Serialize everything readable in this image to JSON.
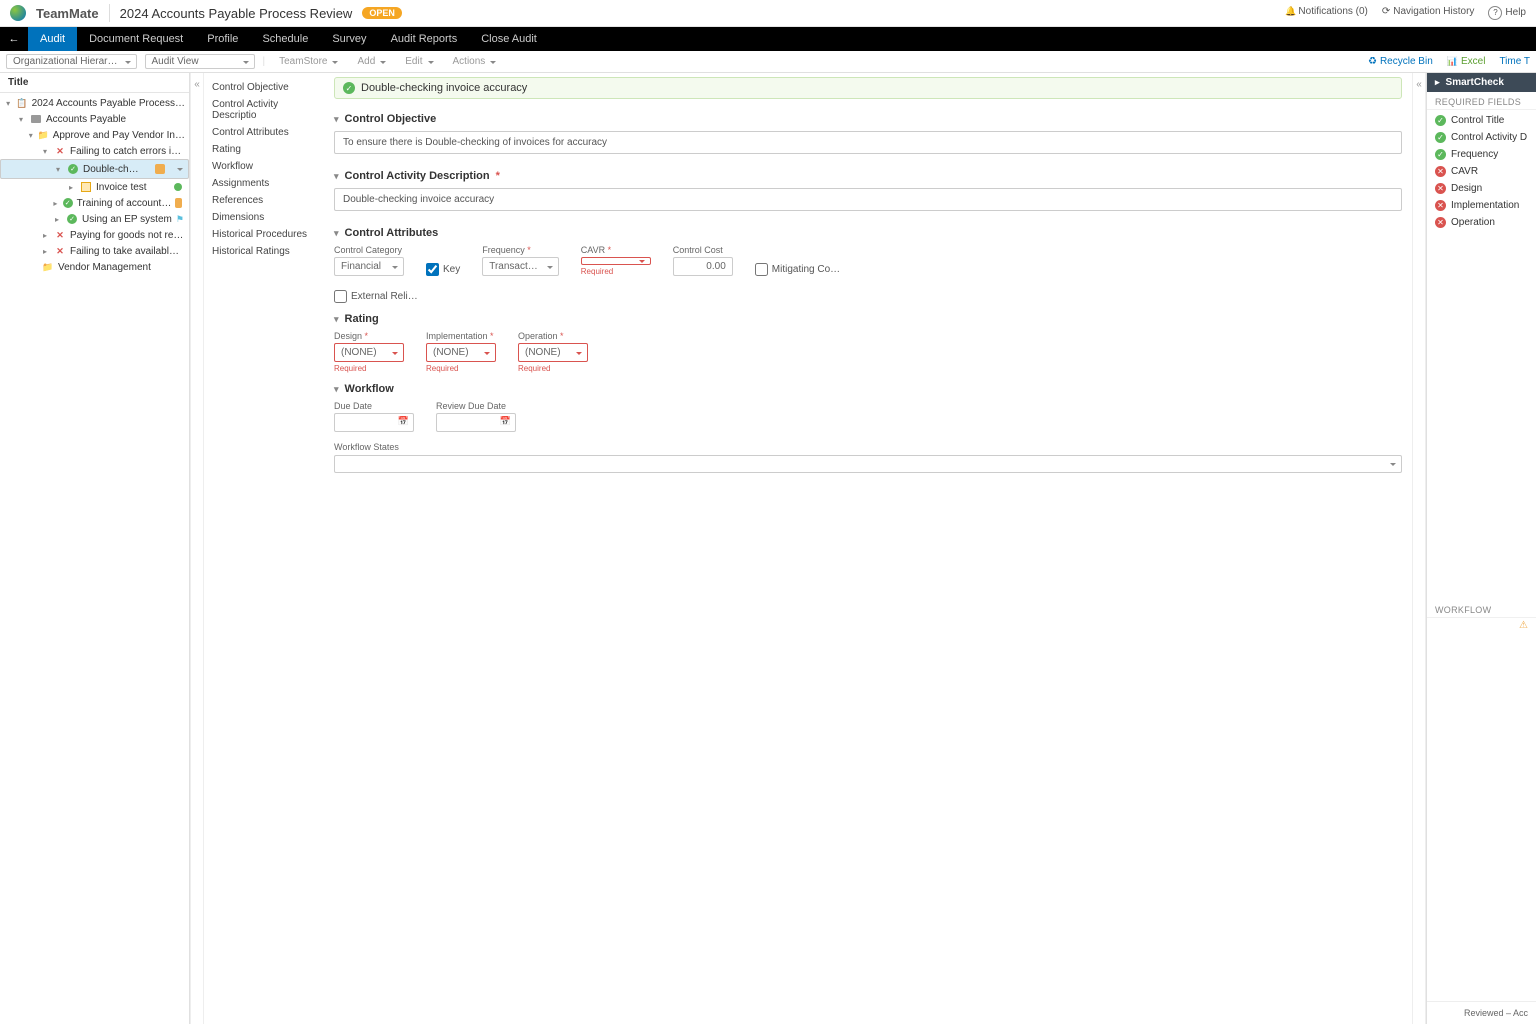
{
  "header": {
    "app": "TeamMate",
    "title": "2024 Accounts Payable Process Review",
    "status": "OPEN",
    "notifications": "Notifications (0)",
    "navhistory": "Navigation History",
    "help": "Help"
  },
  "blackbar": {
    "tabs": [
      "Audit",
      "Document Request",
      "Profile",
      "Schedule",
      "Survey",
      "Audit Reports",
      "Close Audit"
    ],
    "active": 0
  },
  "toolbar": {
    "hierarchy": "Organizational Hierar…",
    "view": "Audit View",
    "team": "TeamStore",
    "add": "Add",
    "edit": "Edit",
    "actions": "Actions",
    "recycle": "Recycle Bin",
    "excel": "Excel",
    "timetr": "Time T"
  },
  "tree": {
    "head": "Title",
    "n0": "2024 Accounts Payable Process…",
    "n1": "Accounts Payable",
    "n2": "Approve and Pay Vendor In…",
    "n3": "Failing to catch errors i…",
    "n4": "Double-ch…",
    "n5": "Invoice test",
    "n6": "Training of account…",
    "n7": "Using an EP system",
    "n8": "Paying for goods not re…",
    "n9": "Failing to take availabl…",
    "n10": "Vendor Management"
  },
  "sidenav": {
    "s0": "Control Objective",
    "s1": "Control Activity Descriptio",
    "s2": "Control Attributes",
    "s3": "Rating",
    "s4": "Workflow",
    "s5": "Assignments",
    "s6": "References",
    "s7": "Dimensions",
    "s8": "Historical Procedures",
    "s9": "Historical Ratings"
  },
  "content": {
    "crumb": "Double-checking invoice accuracy",
    "sect_obj": "Control Objective",
    "obj_text": "To ensure there is Double-checking of invoices for accuracy",
    "sect_desc": "Control Activity Description",
    "desc_text": "Double-checking invoice accuracy",
    "sect_attr": "Control Attributes",
    "attrs": {
      "cat_label": "Control Category",
      "cat_value": "Financial",
      "key_label": "Key",
      "freq_label": "Frequency",
      "freq_value": "Transact…",
      "cavr_label": "CAVR",
      "cavr_value": "",
      "cost_label": "Control Cost",
      "cost_value": "0.00",
      "mitig_label": "Mitigating Co…",
      "extrel_label": "External Reli…",
      "required": "Required"
    },
    "sect_rating": "Rating",
    "rating": {
      "design": "Design",
      "impl": "Implementation",
      "oper": "Operation",
      "none": "(NONE)",
      "required": "Required"
    },
    "sect_wf": "Workflow",
    "wf": {
      "due": "Due Date",
      "revdue": "Review Due Date",
      "states": "Workflow States"
    }
  },
  "right": {
    "head": "SmartCheck",
    "required": "REQUIRED FIELDS",
    "items": [
      {
        "label": "Control Title",
        "ok": true
      },
      {
        "label": "Control Activity D",
        "ok": true
      },
      {
        "label": "Frequency",
        "ok": true
      },
      {
        "label": "CAVR",
        "ok": false
      },
      {
        "label": "Design",
        "ok": false
      },
      {
        "label": "Implementation",
        "ok": false
      },
      {
        "label": "Operation",
        "ok": false
      }
    ],
    "wf": "WORKFLOW",
    "rev": "Reviewed – Acc"
  }
}
